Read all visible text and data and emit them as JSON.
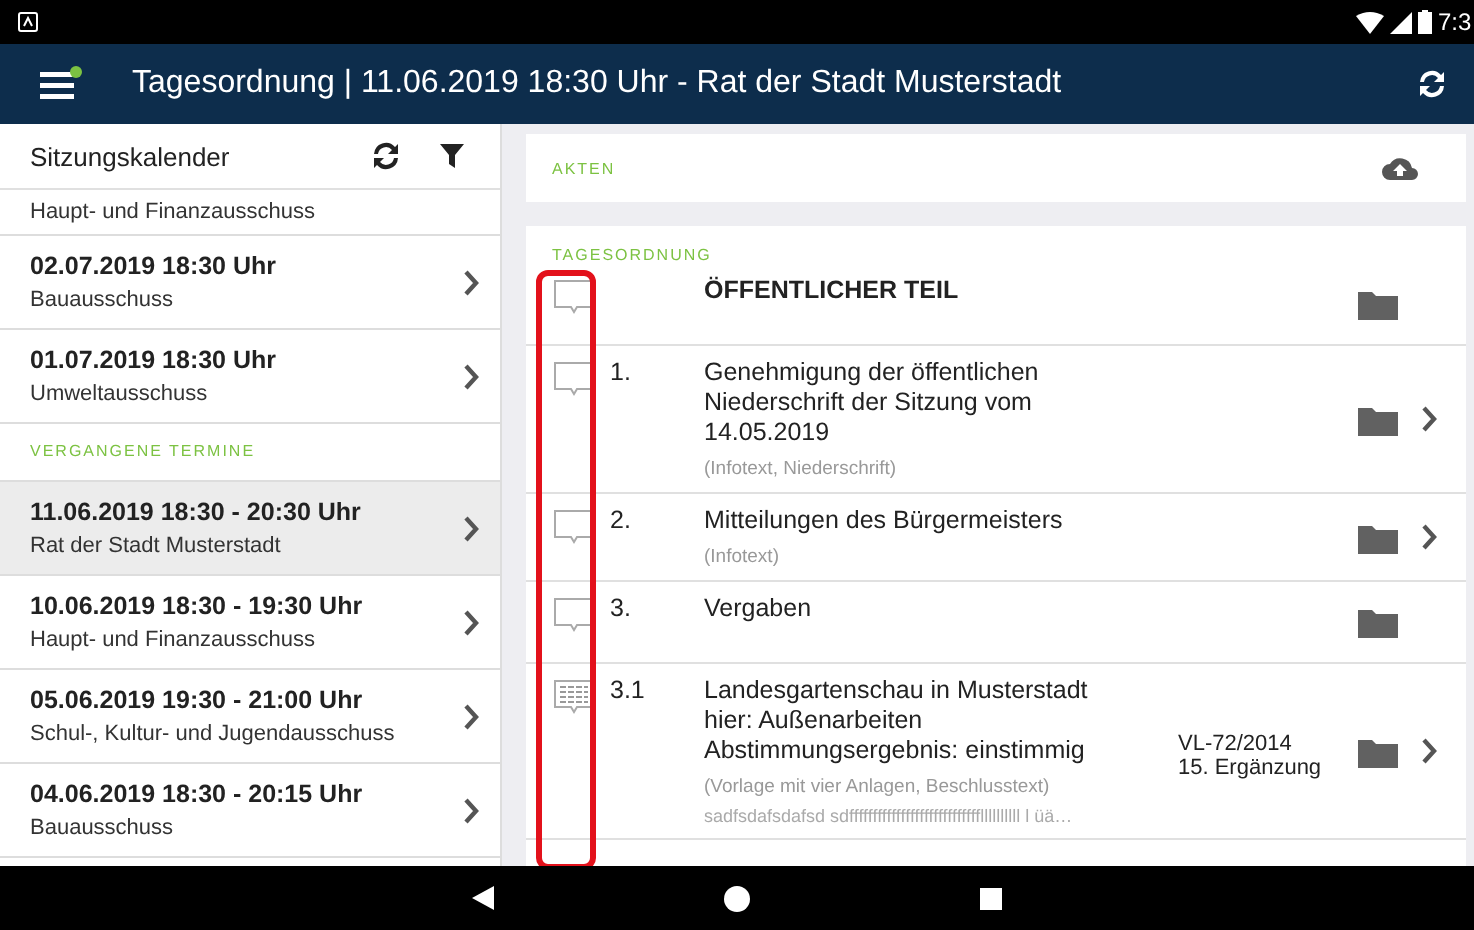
{
  "status_bar": {
    "time": "7:3"
  },
  "app_bar": {
    "title": "Tagesordnung | 11.06.2019 18:30 Uhr - Rat der Stadt Musterstadt",
    "menu_badge": true
  },
  "sidebar": {
    "title": "Sitzungskalender",
    "items": [
      {
        "kind": "meeting",
        "committee": "Haupt- und Finanzausschuss",
        "selected": false,
        "partial": true
      },
      {
        "kind": "meeting",
        "date": "02.07.2019 18:30 Uhr",
        "committee": "Bauausschuss",
        "selected": false,
        "partial": false
      },
      {
        "kind": "meeting",
        "date": "01.07.2019 18:30 Uhr",
        "committee": "Umweltausschuss",
        "selected": false,
        "partial": false
      },
      {
        "kind": "section",
        "label": "VERGANGENE TERMINE"
      },
      {
        "kind": "meeting",
        "date": "11.06.2019 18:30 - 20:30 Uhr",
        "committee": "Rat der Stadt Musterstadt",
        "selected": true,
        "partial": false
      },
      {
        "kind": "meeting",
        "date": "10.06.2019 18:30 - 19:30 Uhr",
        "committee": "Haupt- und Finanzausschuss",
        "selected": false,
        "partial": false
      },
      {
        "kind": "meeting",
        "date": "05.06.2019 19:30 - 21:00 Uhr",
        "committee": "Schul-, Kultur- und Jugendausschuss",
        "selected": false,
        "partial": false
      },
      {
        "kind": "meeting",
        "date": "04.06.2019 18:30 - 20:15 Uhr",
        "committee": "Bauausschuss",
        "selected": false,
        "partial": false
      }
    ]
  },
  "files_card": {
    "label": "AKTEN"
  },
  "agenda": {
    "label": "TAGESORDNUNG",
    "items": [
      {
        "kind": "comment",
        "title": "ÖFFENTLICHER TEIL",
        "heading": true,
        "has_chevron": false
      },
      {
        "kind": "comment",
        "number": "1.",
        "title": "Genehmigung der öffentlichen\nNiederschrift der Sitzung vom\n14.05.2019",
        "heading": false,
        "info": "(Infotext, Niederschrift)",
        "has_chevron": true
      },
      {
        "kind": "comment",
        "number": "2.",
        "title": "Mitteilungen des Bürgermeisters",
        "heading": false,
        "info": "(Infotext)",
        "has_chevron": true
      },
      {
        "kind": "comment",
        "number": "3.",
        "title": "Vergaben",
        "heading": false,
        "has_chevron": false
      },
      {
        "kind": "note",
        "number": "3.1",
        "title": "Landesgartenschau in Musterstadt\nhier: Außenarbeiten\nAbstimmungsergebnis: einstimmig",
        "heading": false,
        "info": "(Vorlage mit vier Anlagen, Beschlusstext)",
        "reference": "VL-72/2014\n15. Ergänzung",
        "extra": "sadfsdafsdafsd sdffffffffffffffffffffffffffffllllllllll l üä…",
        "has_chevron": true
      }
    ]
  }
}
